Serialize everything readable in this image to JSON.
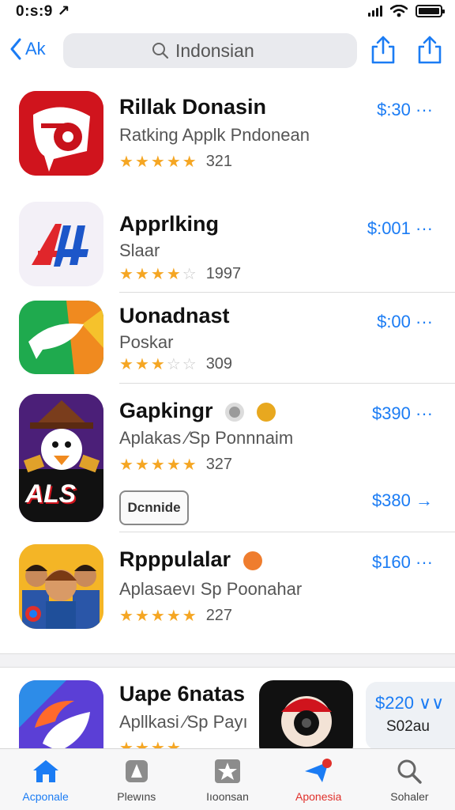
{
  "status_bar": {
    "time": "0:s:9 ↗"
  },
  "nav": {
    "back_label": "Ak",
    "search_value": "Indonsian"
  },
  "apps": [
    {
      "name": "Rillak Donasin",
      "subtitle": "Ratking Applk Pndonean",
      "stars": 4.5,
      "rating_count": "321",
      "price": "$:30 ···"
    },
    {
      "name": "Apprlking",
      "subtitle": "Slaar",
      "stars": 4,
      "rating_count": "1997",
      "price": "$:001 ···"
    },
    {
      "name": "Uonadnast",
      "subtitle": "Poskar",
      "stars": 3,
      "rating_count": "309",
      "price": "$:00 ···"
    },
    {
      "name": "Gapkingr",
      "subtitle": "Aplakas ⁄Sp Ponnnaim",
      "stars": 4.5,
      "rating_count": "327",
      "price": "$390 ···",
      "action_label": "Dcnnide",
      "action_price": "$380 →",
      "icon_text": "ALS"
    },
    {
      "name": "Rpppulalar",
      "subtitle": "Aplasaevı Sp Poonahar",
      "stars": 4.5,
      "rating_count": "227",
      "price": "$160 ···"
    },
    {
      "name": "Uape 6natas",
      "subtitle": "Apllkasi ⁄Sp Payı",
      "stars": 4.5,
      "rating_count": "",
      "price": ""
    }
  ],
  "side_card": {
    "price": "$220 ∨∨",
    "label": "S02au"
  },
  "tabs": [
    {
      "label": "Acponale",
      "icon": "home-icon"
    },
    {
      "label": "Plewıns",
      "icon": "apps-icon"
    },
    {
      "label": "Iıoonsan",
      "icon": "star-icon"
    },
    {
      "label": "Aponesia",
      "icon": "plane-icon"
    },
    {
      "label": "Sohaler",
      "icon": "search-icon"
    }
  ],
  "colors": {
    "accent": "#1b7cf4",
    "star": "#f5a623",
    "alert": "#e0302b"
  }
}
